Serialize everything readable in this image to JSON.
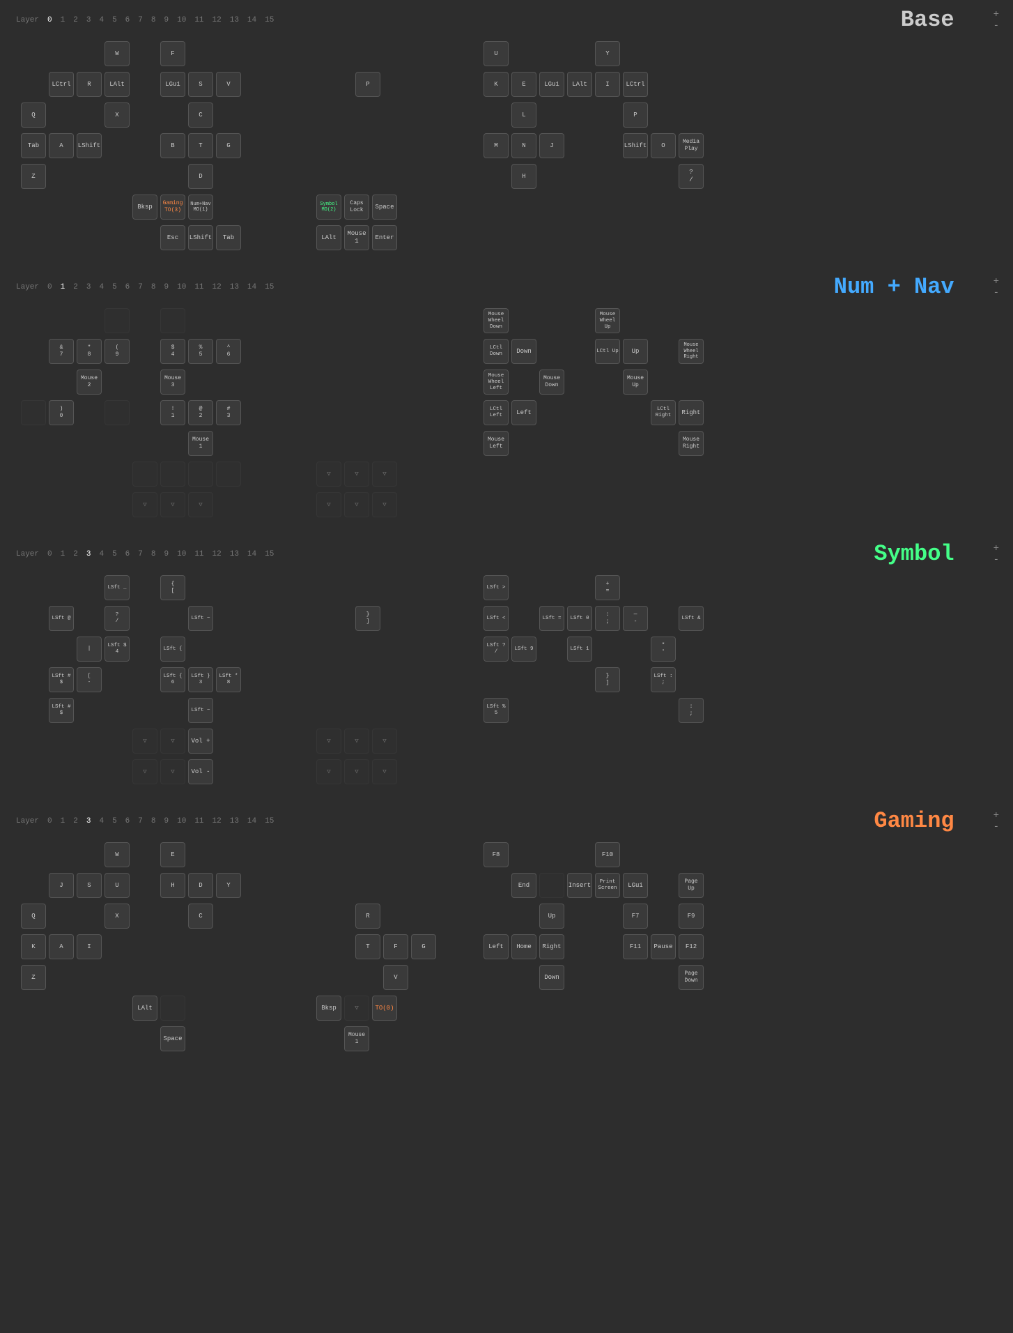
{
  "layers": [
    {
      "id": "base",
      "title": "Base",
      "title_class": "base",
      "active_num": 0,
      "nums": [
        "0",
        "1",
        "2",
        "3",
        "4",
        "5",
        "6",
        "7",
        "8",
        "9",
        "10",
        "11",
        "12",
        "13",
        "14",
        "15"
      ],
      "rows_left": [
        [
          "",
          "W",
          "",
          "F"
        ],
        [
          "LCtrl",
          "R",
          "LAlt",
          "LGui",
          "S",
          "V"
        ],
        [
          "Q",
          "",
          "X",
          "",
          "C",
          ""
        ],
        [
          "Tab",
          "A",
          "LShift",
          "",
          "B",
          "T",
          "G"
        ],
        [
          "Z",
          "",
          "",
          "",
          "D",
          ""
        ],
        [
          "",
          "",
          "",
          "Bksp",
          "Gaming\nTO(3)",
          "Num+Nav\nMO(1)"
        ],
        [
          "",
          "",
          "",
          "Esc",
          "LShift",
          "Tab"
        ]
      ],
      "rows_right": [
        [
          "U",
          "",
          "Y",
          ""
        ],
        [
          "K",
          "E",
          "LGui",
          "LAlt",
          "I",
          "LCtrl"
        ],
        [
          "",
          "L",
          "",
          "",
          "",
          "P"
        ],
        [
          "M",
          "N",
          "J",
          "",
          "",
          "LShift",
          "O",
          "Media\nPlay"
        ],
        [
          "",
          "H",
          "",
          "",
          "",
          "",
          "?"
        ],
        [
          "Symbol\nMO(2)",
          "Caps\nLock",
          "Space",
          "",
          "",
          ""
        ],
        [
          "LAlt",
          "Mouse\n1",
          "Enter",
          "",
          "",
          ""
        ]
      ]
    },
    {
      "id": "num-nav",
      "title": "Num + Nav",
      "title_class": "num",
      "active_num": 1,
      "nums": [
        "0",
        "1",
        "2",
        "3",
        "4",
        "5",
        "6",
        "7",
        "8",
        "9",
        "10",
        "11",
        "12",
        "13",
        "14",
        "15"
      ]
    },
    {
      "id": "symbol",
      "title": "Symbol",
      "title_class": "symbol",
      "active_num": 2,
      "nums": [
        "0",
        "1",
        "2",
        "3",
        "4",
        "5",
        "6",
        "7",
        "8",
        "9",
        "10",
        "11",
        "12",
        "13",
        "14",
        "15"
      ]
    },
    {
      "id": "gaming",
      "title": "Gaming",
      "title_class": "gaming",
      "active_num": 3,
      "nums": [
        "0",
        "1",
        "2",
        "3",
        "4",
        "5",
        "6",
        "7",
        "8",
        "9",
        "10",
        "11",
        "12",
        "13",
        "14",
        "15"
      ]
    }
  ],
  "controls": {
    "plus": "+",
    "minus": "-"
  }
}
